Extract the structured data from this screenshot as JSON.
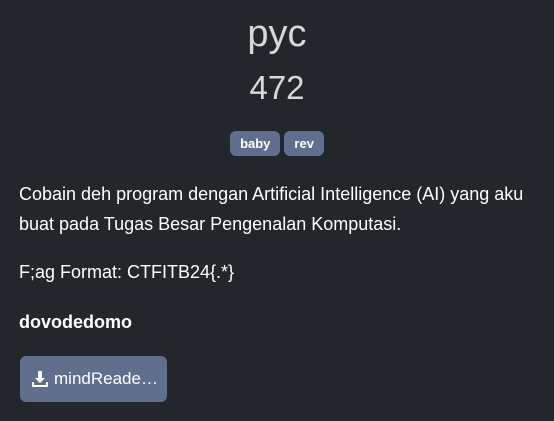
{
  "challenge": {
    "name": "pyc",
    "points": "472",
    "tags": [
      "baby",
      "rev"
    ],
    "description": "Cobain deh program dengan Artificial Intelligence (AI) yang aku buat pada Tugas Besar Pengenalan Komputasi.",
    "flag_format": "F;ag Format: CTFITB24{.*}",
    "author": "dovodedomo",
    "file": {
      "label": "mindReade…",
      "icon": "download-icon"
    }
  },
  "colors": {
    "background": "#23262b",
    "tag_bg": "#5f6f8d",
    "button_bg": "#5f6f8d"
  }
}
